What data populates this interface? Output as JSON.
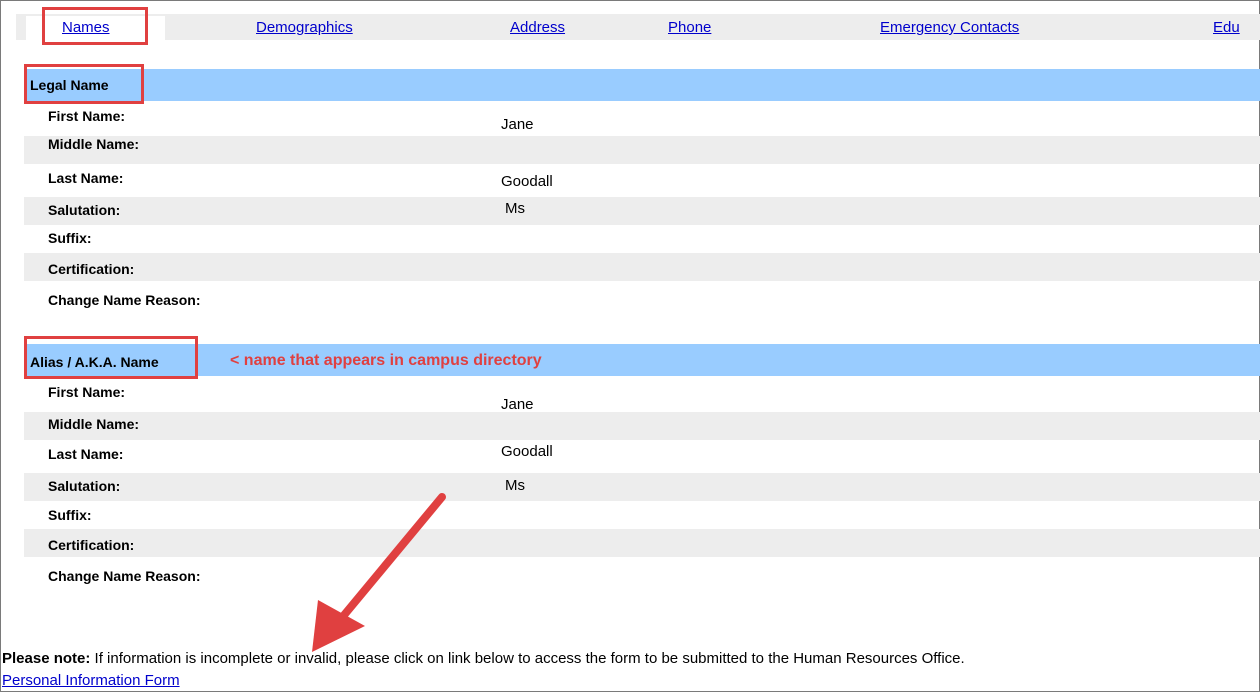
{
  "tabs": [
    {
      "label": "Names"
    },
    {
      "label": "Demographics"
    },
    {
      "label": "Address"
    },
    {
      "label": "Phone"
    },
    {
      "label": "Emergency Contacts"
    },
    {
      "label": "Edu"
    }
  ],
  "legal": {
    "title": "Legal Name",
    "rows": [
      {
        "label": "First Name:",
        "value": "Jane"
      },
      {
        "label": "Middle Name:",
        "value": ""
      },
      {
        "label": "Last Name:",
        "value": "Goodall"
      },
      {
        "label": "Salutation:",
        "value": "Ms"
      },
      {
        "label": "Suffix:",
        "value": ""
      },
      {
        "label": "Certification:",
        "value": ""
      },
      {
        "label": "Change Name Reason:",
        "value": ""
      }
    ]
  },
  "alias": {
    "title": "Alias / A.K.A. Name",
    "annotation": "< name that appears in campus directory",
    "rows": [
      {
        "label": "First Name:",
        "value": "Jane"
      },
      {
        "label": "Middle Name:",
        "value": ""
      },
      {
        "label": "Last Name:",
        "value": "Goodall"
      },
      {
        "label": "Salutation:",
        "value": "Ms"
      },
      {
        "label": "Suffix:",
        "value": ""
      },
      {
        "label": "Certification:",
        "value": ""
      },
      {
        "label": "Change Name Reason:",
        "value": ""
      }
    ]
  },
  "footer": {
    "note_bold": "Please note:",
    "note_text": " If information is incomplete or invalid, please click on link below to access the form to be submitted to the Human Resources Office.",
    "link": "Personal Information Form"
  },
  "colors": {
    "highlight": "#e04040",
    "section_bg": "#99ccff",
    "link": "#0000cc"
  }
}
